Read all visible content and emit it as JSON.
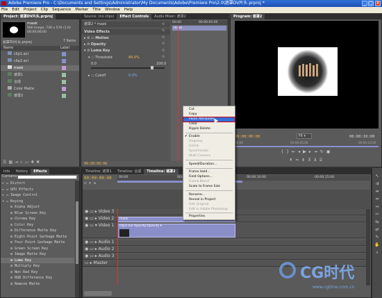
{
  "window": {
    "title": "Adobe Premiere Pro - C:\\Documents and Settings\\Administrator\\My Documents\\Adobe\\Premiere Pro\\2.0\\遮罩DV片头.prproj *"
  },
  "menu": [
    "File",
    "Edit",
    "Project",
    "Clip",
    "Sequence",
    "Marker",
    "Title",
    "Window",
    "Help"
  ],
  "project": {
    "tab": "Project: 遮罩DV片头.prproj",
    "clip_name": "mask",
    "clip_info": "Still Image, 720 x 576 (1.0)",
    "clip_duration": "00:00:06:00",
    "proj_name": "遮罩DV片头.prproj",
    "item_count": "7 Items",
    "col_name": "Name",
    "col_label": "Label",
    "items": [
      "clip1.avi",
      "clip2.avi",
      "mask",
      "遮罩1",
      "合成",
      "Color Matte",
      "遮罩2"
    ]
  },
  "effect_controls": {
    "tabs": [
      "Source: (no clips)",
      "Effect Controls",
      "Audio Mixer: 遮罩2"
    ],
    "header": "遮罩2 * mask",
    "video_effects": "Video Effects",
    "motion": "Motion",
    "opacity": "Opacity",
    "luma_key": "Luma Key",
    "threshold_label": "Threshold",
    "threshold_value": "84.0%",
    "threshold_min": "0.0",
    "threshold_max": "100.0",
    "threshold_level": 0.84,
    "cutoff_label": "Cutoff",
    "cutoff_value": "0.0%",
    "timecode_start": "00:00",
    "timecode_end": "00:00:05:00",
    "clip_label": "mask",
    "bottom_timecode": "00:00:00:00"
  },
  "program": {
    "tab": "Program: 遮罩2",
    "timecode_left": "00:00:00:00",
    "fit": "Fit",
    "timecode_right": "00:00:10:00",
    "ruler_left": "00:00",
    "ruler_mid": "00:00:05:00",
    "ruler_right": "00:00:10:00"
  },
  "effects": {
    "tabs": [
      "Info",
      "History",
      "Effects"
    ],
    "contains": "Contains:",
    "items": [
      "Distort",
      "GPU Effects",
      "Image Control",
      "Keying",
      "Alpha Adjust",
      "Blue Screen Key",
      "Chroma Key",
      "Color Key",
      "Difference Matte Key",
      "Eight-Point Garbage Matte",
      "Four-Point Garbage Matte",
      "Green Screen Key",
      "Image Matte Key",
      "Luma Key",
      "Multiply Key",
      "Non Red Key",
      "RGB Difference Key",
      "Remove Matte"
    ]
  },
  "timeline": {
    "tabs": [
      "Timeline: 遮罩1",
      "Timeline: 合成",
      "Timeline: 遮罩2"
    ],
    "timecode": "00:00:00:00",
    "ruler": [
      "00:00",
      "00:00:05:00",
      "00:00:10:00",
      "00:00:15:00"
    ],
    "tracks": [
      "Video 3",
      "Video 2",
      "Video 1",
      "Audio 1",
      "Audio 2",
      "Audio 3",
      "Master"
    ],
    "clip_mask": "mask",
    "clip_avi": "clip2.avi  Opacity:Opacity ▾"
  },
  "context_menu": {
    "items": [
      "Cut",
      "Copy",
      "Paste Attributes",
      "Clear",
      "Ripple Delete",
      "Enable",
      "Ungroup",
      "Unlink",
      "Synchronize",
      "Multi-Camera",
      "Speed/Duration...",
      "Frame Hold...",
      "Field Options...",
      "Frame Blend",
      "Scale to Frame Size",
      "Rename...",
      "Reveal in Project",
      "Edit Original",
      "Edit in Adobe Photoshop",
      "Properties"
    ],
    "selected": "Paste Attributes",
    "check": "✔"
  },
  "watermark": {
    "brand": "CG时代",
    "url": "www.cgtime.com.cn"
  },
  "colors": {
    "accent": "#3a6cd6",
    "yellow": "#e8b84a",
    "menu_bg": "#ece9d8"
  }
}
